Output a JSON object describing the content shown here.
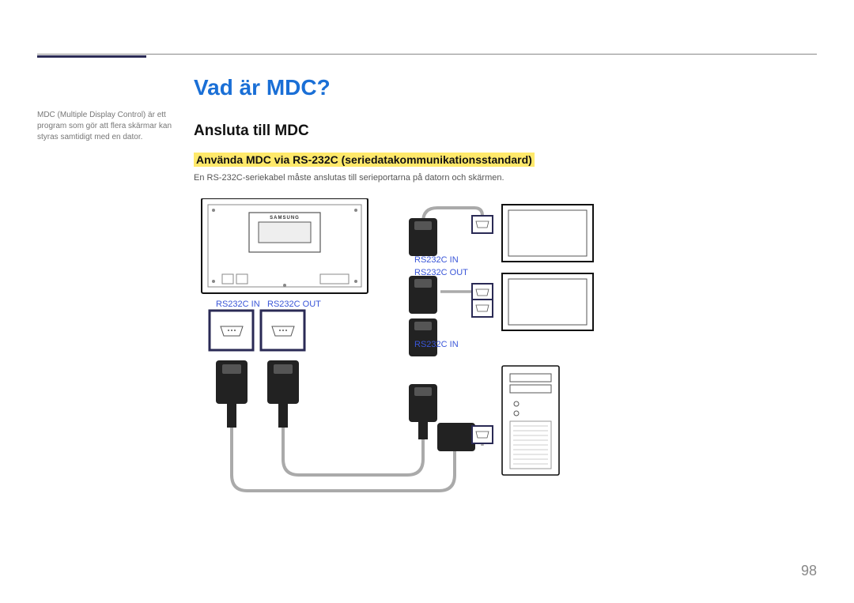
{
  "page": {
    "sidebar_note": "MDC (Multiple Display Control) är ett program som gör att flera skärmar kan styras samtidigt med en dator.",
    "h1": "Vad är MDC?",
    "h2": "Ansluta till MDC",
    "h3": "Använda MDC via RS-232C (seriedatakommunikationsstandard)",
    "body": "En RS-232C-seriekabel måste anslutas till serieportarna på datorn och skärmen.",
    "labels": {
      "rs232c_in": "RS232C IN",
      "rs232c_out": "RS232C OUT"
    },
    "page_number": "98"
  }
}
